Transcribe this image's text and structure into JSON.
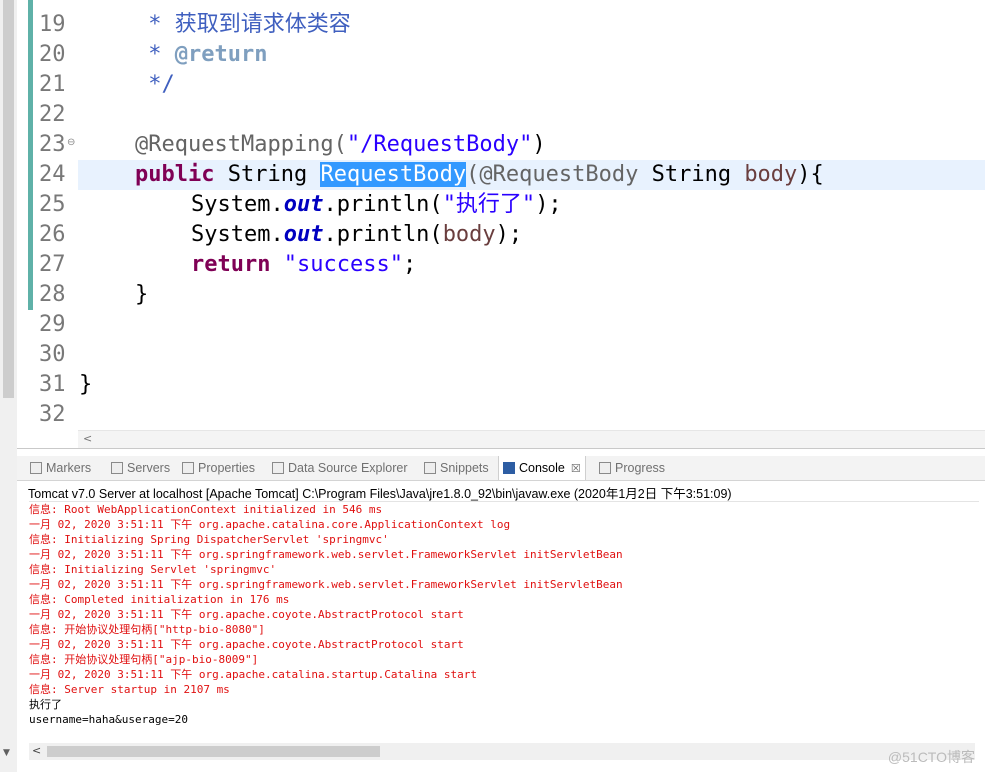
{
  "editor": {
    "line_numbers": [
      "19",
      "20",
      "21",
      "22",
      "23",
      "24",
      "25",
      "26",
      "27",
      "28",
      "29",
      "30",
      "31",
      "32"
    ],
    "lines": {
      "l19_comment": " * 获取到请求体类容",
      "l20_star": " * ",
      "l20_tag": "@return",
      "l21_comment": " */",
      "l23_annotation": "@RequestMapping(",
      "l23_string": "\"/RequestBody\"",
      "l23_close": ")",
      "l24_public": "public",
      "l24_type": " String ",
      "l24_method": "RequestBody",
      "l24_param_ann": "(@RequestBody",
      "l24_param_type": " String ",
      "l24_param_name": "body",
      "l24_open": "){",
      "l25_sys": "System.",
      "l25_out": "out",
      "l25_println": ".println(",
      "l25_string": "\"执行了\"",
      "l25_end": ");",
      "l26_sys": "System.",
      "l26_out": "out",
      "l26_println": ".println(",
      "l26_arg": "body",
      "l26_end": ");",
      "l27_return": "return",
      "l27_string": "\"success\"",
      "l27_end": ";",
      "l28_close": "}",
      "l31_close": "}"
    },
    "hscroll_left": "<"
  },
  "views": {
    "tabs": [
      {
        "label": "Markers"
      },
      {
        "label": "Servers"
      },
      {
        "label": "Properties"
      },
      {
        "label": "Data Source Explorer"
      },
      {
        "label": "Snippets"
      },
      {
        "label": "Console"
      },
      {
        "label": "Progress"
      }
    ],
    "console_close": "☒",
    "console_description": "Tomcat v7.0 Server at localhost [Apache Tomcat] C:\\Program Files\\Java\\jre1.8.0_92\\bin\\javaw.exe (2020年1月2日 下午3:51:09)",
    "console_lines": [
      "信息: Root WebApplicationContext initialized in 546 ms",
      "一月 02, 2020 3:51:11 下午 org.apache.catalina.core.ApplicationContext log",
      "信息: Initializing Spring DispatcherServlet 'springmvc'",
      "一月 02, 2020 3:51:11 下午 org.springframework.web.servlet.FrameworkServlet initServletBean",
      "信息: Initializing Servlet 'springmvc'",
      "一月 02, 2020 3:51:11 下午 org.springframework.web.servlet.FrameworkServlet initServletBean",
      "信息: Completed initialization in 176 ms",
      "一月 02, 2020 3:51:11 下午 org.apache.coyote.AbstractProtocol start",
      "信息: 开始协议处理句柄[\"http-bio-8080\"]",
      "一月 02, 2020 3:51:11 下午 org.apache.coyote.AbstractProtocol start",
      "信息: 开始协议处理句柄[\"ajp-bio-8009\"]",
      "一月 02, 2020 3:51:11 下午 org.apache.catalina.startup.Catalina start",
      "信息: Server startup in 2107 ms"
    ],
    "console_output": [
      "执行了",
      "username=haha&userage=20"
    ],
    "hscroll_left": "<"
  },
  "watermark": "@51CTO博客",
  "colors": {
    "keyword": "#7f0055",
    "string": "#2a00ff",
    "comment": "#3f5fbf",
    "selection": "#3399ff",
    "error_text": "#e01010"
  }
}
